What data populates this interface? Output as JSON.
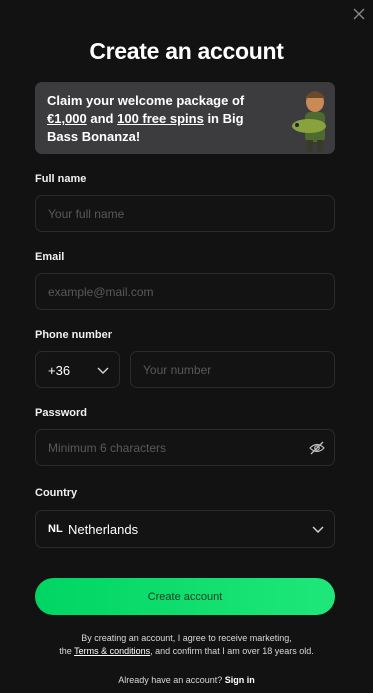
{
  "title": "Create an account",
  "promo": {
    "line1": "Claim your welcome package of",
    "amount": "€1,000",
    "and": " and ",
    "spins": "100 free spins",
    "rest": " in Big Bass Bonanza!"
  },
  "fields": {
    "full_name": {
      "label": "Full name",
      "placeholder": "Your full name"
    },
    "email": {
      "label": "Email",
      "placeholder": "example@mail.com"
    },
    "phone": {
      "label": "Phone number",
      "code": "+36",
      "placeholder": "Your number"
    },
    "password": {
      "label": "Password",
      "placeholder": "Minimum 6 characters"
    },
    "country": {
      "label": "Country",
      "flag_code": "NL",
      "value": "Netherlands"
    }
  },
  "submit_label": "Create account",
  "consent": {
    "line1": "By creating an account, I agree to receive marketing,",
    "the": "the ",
    "terms_link": "Terms & conditions",
    "line2": ", and confirm that I am over 18 years old."
  },
  "signin": {
    "prompt": "Already have an account? ",
    "link": "Sign in"
  },
  "icons": {
    "close": "close-icon",
    "eye": "eye-off-icon",
    "chevron": "chevron-down-icon"
  },
  "colors": {
    "background": "#121212",
    "accent": "#1fe77a",
    "promo_bg": "#3c3c3e"
  }
}
